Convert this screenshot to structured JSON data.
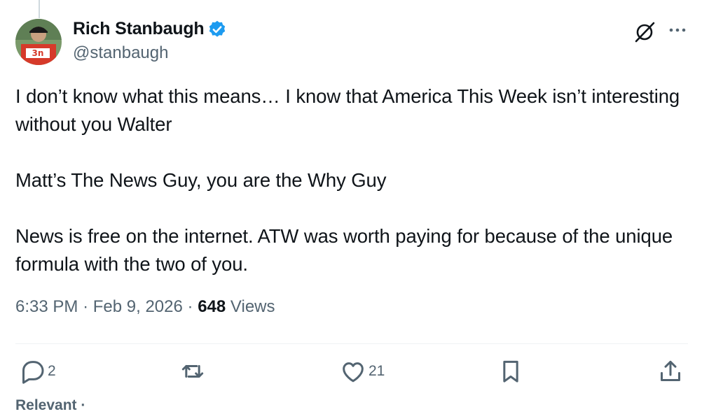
{
  "author": {
    "display_name": "Rich Stanbaugh",
    "handle": "@stanbaugh",
    "verified": true
  },
  "tweet": {
    "paragraphs": [
      "I don’t know what this means… I know that America This Week isn’t interesting without you Walter",
      "Matt’s The News Guy, you are the Why Guy",
      "News is free on the internet. ATW was worth paying for because of the unique formula with the two of you."
    ]
  },
  "meta": {
    "time": "6:33 PM",
    "separator": "·",
    "date": "Feb 9, 2026",
    "views_count": "648",
    "views_label": "Views"
  },
  "actions": {
    "reply_count": "2",
    "retweet_count": "",
    "like_count": "21"
  },
  "footer": {
    "sort_label": "Relevant ·"
  },
  "colors": {
    "accent": "#1d9bf0",
    "secondary_text": "#536471",
    "primary_text": "#0f1419",
    "divider": "#eff3f4"
  },
  "icons": {
    "verified": "verified-badge-icon",
    "grok": "grok-icon",
    "more": "more-icon",
    "reply": "reply-icon",
    "retweet": "retweet-icon",
    "like": "like-icon",
    "bookmark": "bookmark-icon",
    "share": "share-icon"
  }
}
